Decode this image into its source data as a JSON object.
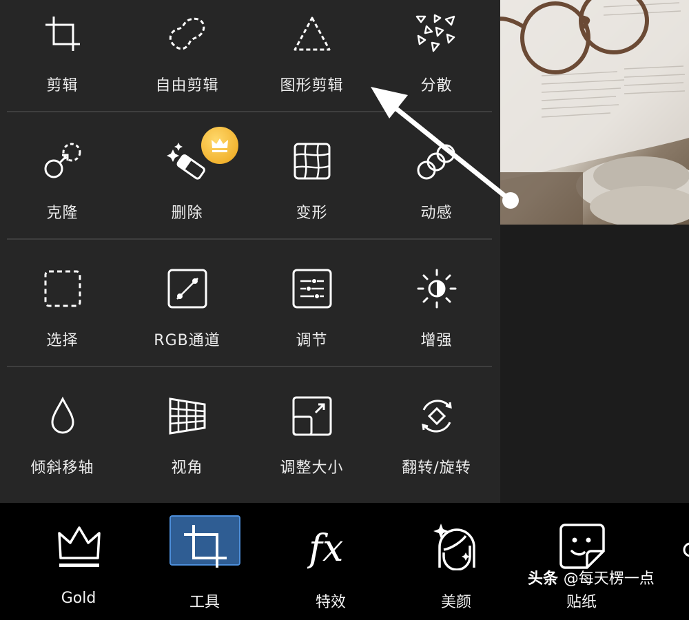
{
  "tools": {
    "rows": [
      [
        {
          "label": "剪辑",
          "icon": "crop-icon"
        },
        {
          "label": "自由剪辑",
          "icon": "freeform-crop-icon"
        },
        {
          "label": "图形剪辑",
          "icon": "shape-crop-icon"
        },
        {
          "label": "分散",
          "icon": "dispersion-icon"
        }
      ],
      [
        {
          "label": "克隆",
          "icon": "clone-icon"
        },
        {
          "label": "删除",
          "icon": "eraser-icon",
          "premium": true
        },
        {
          "label": "变形",
          "icon": "warp-grid-icon"
        },
        {
          "label": "动感",
          "icon": "motion-icon"
        }
      ],
      [
        {
          "label": "选择",
          "icon": "selection-icon"
        },
        {
          "label": "RGB通道",
          "icon": "curves-icon"
        },
        {
          "label": "调节",
          "icon": "adjust-sliders-icon"
        },
        {
          "label": "增强",
          "icon": "enhance-sun-icon"
        }
      ],
      [
        {
          "label": "倾斜移轴",
          "icon": "tilt-shift-drop-icon"
        },
        {
          "label": "视角",
          "icon": "perspective-icon"
        },
        {
          "label": "调整大小",
          "icon": "resize-icon"
        },
        {
          "label": "翻转/旋转",
          "icon": "flip-rotate-icon"
        }
      ]
    ]
  },
  "bottom_bar": {
    "items": [
      {
        "label": "Gold",
        "icon": "crown-icon"
      },
      {
        "label": "工具",
        "icon": "crop-icon",
        "active": true
      },
      {
        "label": "特效",
        "icon": "fx-icon"
      },
      {
        "label": "美颜",
        "icon": "face-beauty-icon"
      },
      {
        "label": "贴纸",
        "icon": "sticker-icon"
      }
    ]
  },
  "watermark": {
    "brand": "头条",
    "handle": "@每天楞一点"
  },
  "colors": {
    "panel": "#262626",
    "active_tab": "#2f5d93",
    "active_border": "#4d8fdb",
    "badge": "#f2b431"
  }
}
